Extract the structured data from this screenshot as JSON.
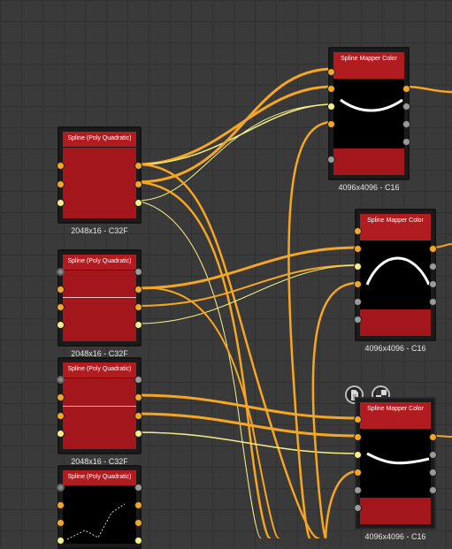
{
  "nodes": [
    {
      "title": "Spline (Poly Quadratic)",
      "caption": "2048x16 - C32F"
    },
    {
      "title": "Spline (Poly Quadratic)",
      "caption": "2048x16 - C32F"
    },
    {
      "title": "Spline (Poly Quadratic)",
      "caption": "2048x16 - C32F"
    },
    {
      "title": "Spline (Poly Quadratic)",
      "caption": ""
    },
    {
      "title": "Spline Mapper Color",
      "caption": "4096x4096 - C16"
    },
    {
      "title": "Spline Mapper Color",
      "caption": "4096x4096 - C16"
    },
    {
      "title": "Spline Mapper Color",
      "caption": "4096x4096 - C16"
    }
  ],
  "colors": {
    "wire_orange": "#f5a623",
    "wire_yellow": "#f4ef8a",
    "node_red": "#b11c21",
    "grid_bg": "#3a3a3a"
  },
  "icons": {
    "node_toolbar": [
      "document-icon",
      "checker-icon"
    ]
  }
}
